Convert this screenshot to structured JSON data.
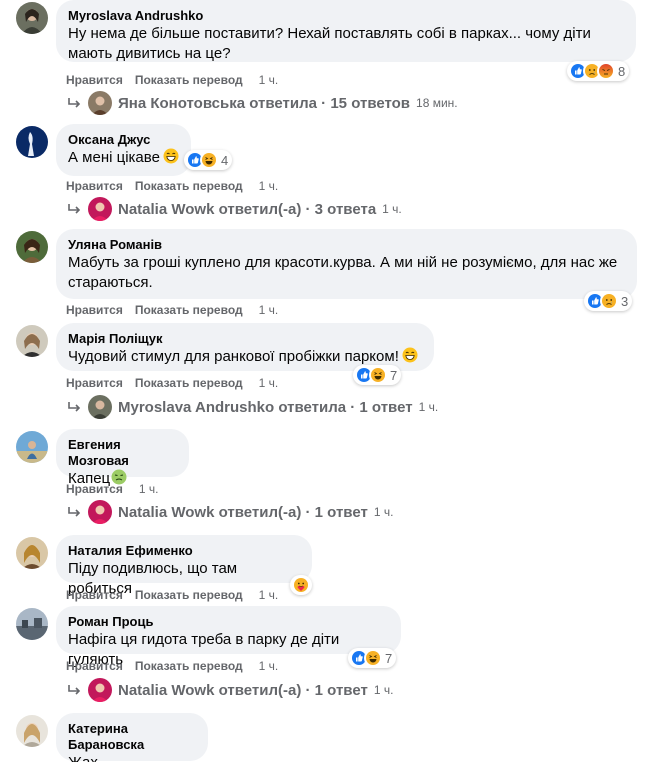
{
  "comments": [
    {
      "author": "Myroslava Andrushko",
      "text": "Ну нема де більше поставити? Нехай поставлять собі в парках... чому діти мають дивитись на це?",
      "actions": {
        "like": "Нравится",
        "translate": "Показать перевод",
        "time": "1 ч."
      },
      "reactions": {
        "icons": [
          "like-icon",
          "sad-icon",
          "angry-icon"
        ],
        "count": "8"
      },
      "reply": {
        "name": "Яна Конотовська ответила",
        "count": "15 ответов",
        "time": "18 мин."
      }
    },
    {
      "author": "Оксана Джус",
      "text": "А мені цікаве",
      "emoji": "grin-emoji",
      "actions": {
        "like": "Нравится",
        "translate": "Показать перевод",
        "time": "1 ч."
      },
      "reactions": {
        "icons": [
          "like-icon",
          "haha-icon"
        ],
        "count": "4"
      },
      "reply": {
        "name": "Natalia Wowk ответил(-а)",
        "count": "3 ответа",
        "time": "1 ч."
      }
    },
    {
      "author": "Уляна Романів",
      "text": "Мабуть за гроші куплено для красоти.курва. А ми ній не розуміємо, для нас же стараються.",
      "actions": {
        "like": "Нравится",
        "translate": "Показать перевод",
        "time": "1 ч."
      },
      "reactions": {
        "icons": [
          "like-icon",
          "sad-icon"
        ],
        "count": "3"
      }
    },
    {
      "author": "Марія Поліщук",
      "text": "Чудовий стимул для ранкової пробіжки парком!",
      "emoji": "grin-emoji",
      "actions": {
        "like": "Нравится",
        "translate": "Показать перевод",
        "time": "1 ч."
      },
      "reactions": {
        "icons": [
          "like-icon",
          "haha-icon"
        ],
        "count": "7"
      },
      "reply": {
        "name": "Myroslava Andrushko ответила",
        "count": "1 ответ",
        "time": "1 ч."
      }
    },
    {
      "author": "Евгения Мозговая",
      "text": "Капец",
      "emoji": "sick-emoji",
      "actions": {
        "like": "Нравится",
        "time": "1 ч."
      },
      "reply": {
        "name": "Natalia Wowk ответил(-а)",
        "count": "1 ответ",
        "time": "1 ч."
      }
    },
    {
      "author": "Наталия Ефименко",
      "text": "Піду подивлюсь, що там робиться",
      "actions": {
        "like": "Нравится",
        "translate": "Показать перевод",
        "time": "1 ч."
      },
      "reactions": {
        "icons": [
          "care-icon"
        ],
        "count": ""
      }
    },
    {
      "author": "Роман Проць",
      "text": "Нафіга ця гидота треба в парку де діти гуляють",
      "actions": {
        "like": "Нравится",
        "translate": "Показать перевод",
        "time": "1 ч."
      },
      "reactions": {
        "icons": [
          "like-icon",
          "haha-icon"
        ],
        "count": "7"
      },
      "reply": {
        "name": "Natalia Wowk ответил(-а)",
        "count": "1 ответ",
        "time": "1 ч."
      }
    },
    {
      "author": "Катерина Барановска",
      "text": "Жах"
    }
  ],
  "colors": {
    "bubble": "#f0f2f5",
    "meta": "#65676b",
    "like": "#1877f2",
    "haha": "#f7b125",
    "angry": "#e9710f"
  }
}
